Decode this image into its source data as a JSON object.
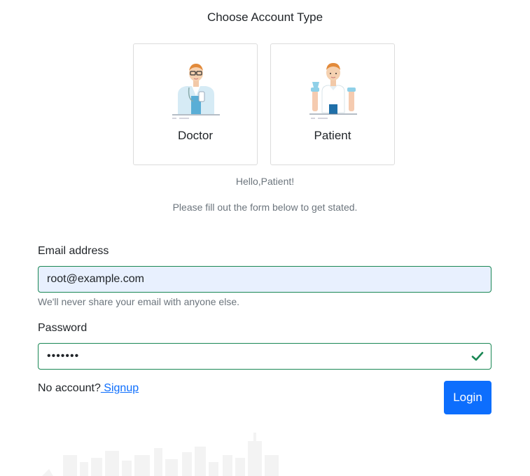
{
  "header": {
    "title": "Choose Account Type"
  },
  "account_types": [
    {
      "label": "Doctor",
      "icon": "doctor-illustration"
    },
    {
      "label": "Patient",
      "icon": "patient-illustration"
    }
  ],
  "greeting": "Hello,Patient!",
  "subtitle": "Please fill out the form below to get stated.",
  "form": {
    "email": {
      "label": "Email address",
      "value": "root@example.com",
      "help": "We'll never share your email with anyone else."
    },
    "password": {
      "label": "Password",
      "value": "1234567",
      "valid_icon": "check-icon"
    },
    "no_account_text": "No account?",
    "signup_label": " Signup",
    "login_label": "Login"
  },
  "colors": {
    "primary": "#0d6efd",
    "valid": "#198754",
    "muted": "#6c757d",
    "autofill_bg": "#e8f0fe"
  }
}
